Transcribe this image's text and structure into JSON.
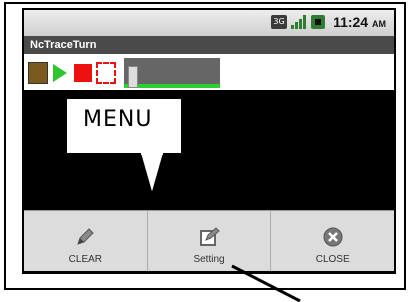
{
  "status_bar": {
    "network_label": "3G",
    "time": "11:24",
    "ampm": "AM"
  },
  "app": {
    "title": "NcTraceTurn"
  },
  "toolbar": {
    "icons": [
      "save-icon",
      "play-icon",
      "stop-icon",
      "fit-icon"
    ],
    "progress_fraction": 0.0
  },
  "callout": {
    "text": "MENU"
  },
  "menu": {
    "items": [
      {
        "label": "CLEAR",
        "icon": "pencil-icon"
      },
      {
        "label": "Setting",
        "icon": "edit-square-icon"
      },
      {
        "label": "CLOSE",
        "icon": "close-circle-icon"
      }
    ]
  }
}
